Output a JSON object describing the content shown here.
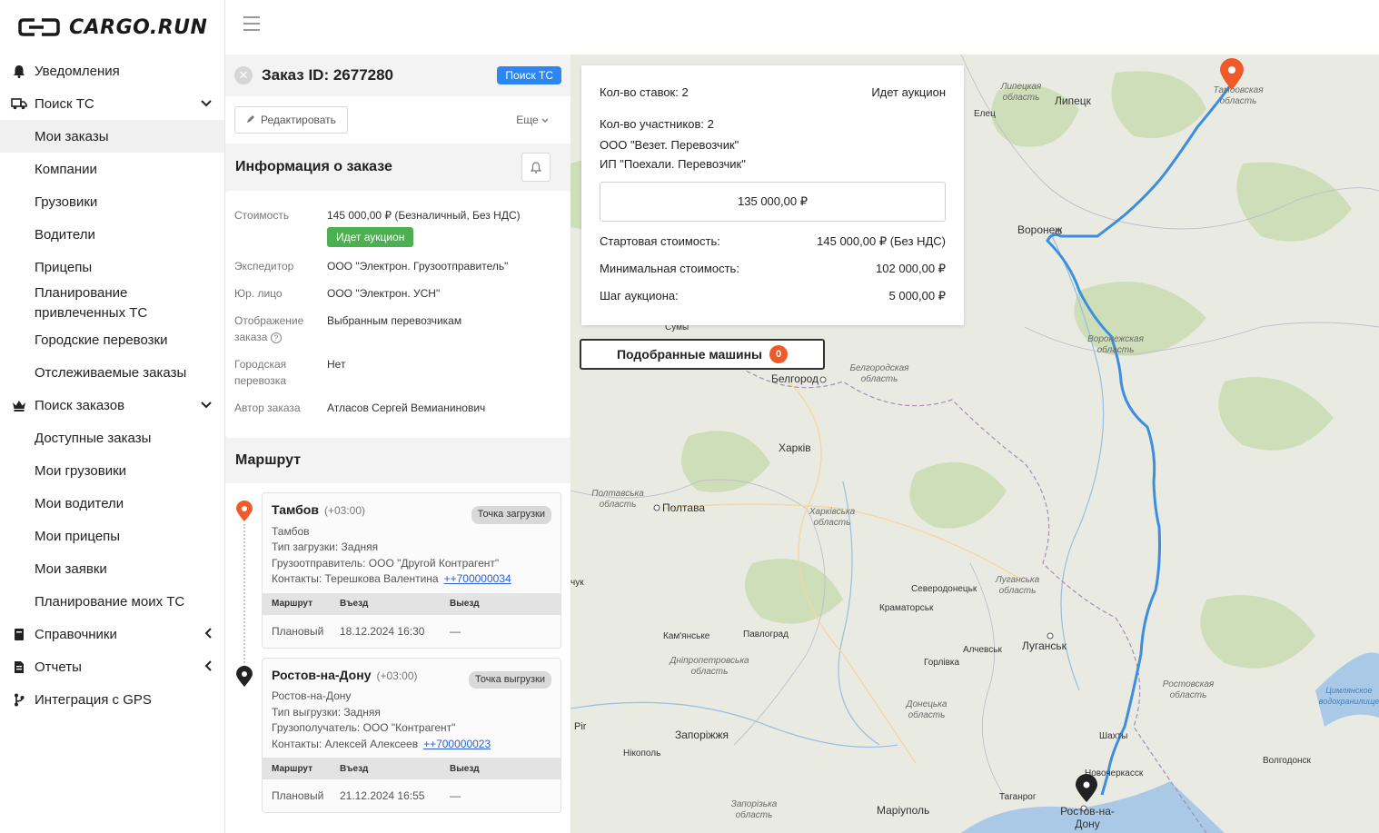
{
  "app": {
    "logo_text": "CARGO.RUN"
  },
  "sidebar": {
    "notifications": "Уведомления",
    "search_vehicles": {
      "label": "Поиск ТС",
      "children": [
        "Мои заказы",
        "Компании",
        "Грузовики",
        "Водители",
        "Прицепы",
        "Планирование привлеченных ТС",
        "Городские перевозки",
        "Отслеживаемые заказы"
      ]
    },
    "search_orders": {
      "label": "Поиск заказов",
      "children": [
        "Доступные заказы",
        "Мои грузовики",
        "Мои водители",
        "Мои прицепы",
        "Мои заявки",
        "Планирование моих ТС"
      ]
    },
    "references": "Справочники",
    "reports": "Отчеты",
    "gps": "Интеграция с GPS"
  },
  "order": {
    "title": "Заказ ID: 2677280",
    "status_badge": "Поиск ТС",
    "edit_label": "Редактировать",
    "more_label": "Еще",
    "info_title": "Информация о заказе",
    "info": {
      "cost_key": "Стоимость",
      "cost_val": "145 000,00 ₽ (Безналичный, Без НДС)",
      "auction_badge": "Идет аукцион",
      "forwarder_key": "Экспедитор",
      "forwarder_val": "ООО \"Электрон. Грузоотправитель\"",
      "legal_key": "Юр. лицо",
      "legal_val": "ООО \"Электрон. УСН\"",
      "display_key": "Отображение заказа",
      "display_val": "Выбранным перевозчикам",
      "city_key": "Городская перевозка",
      "city_val": "Нет",
      "author_key": "Автор заказа",
      "author_val": "Атласов Сергей Вемианинович"
    },
    "route_title": "Маршрут",
    "table_headers": {
      "route": "Маршрут",
      "in": "Въезд",
      "out": "Выезд"
    },
    "stops": [
      {
        "city": "Тамбов",
        "tz": "(+03:00)",
        "type": "Точка загрузки",
        "address": "Тамбов",
        "line1": "Тип загрузки: Задняя",
        "line2": "Грузоотправитель: ООО \"Другой Контрагент\"",
        "contact": "Контакты: Терешкова Валентина",
        "phone": "++700000034",
        "plan_label": "Плановый",
        "plan_in": "18.12.2024 16:30",
        "plan_out": "—"
      },
      {
        "city": "Ростов-на-Дону",
        "tz": "(+03:00)",
        "type": "Точка выгрузки",
        "address": "Ростов-на-Дону",
        "line1": "Тип выгрузки: Задняя",
        "line2": "Грузополучатель: ООО \"Контрагент\"",
        "contact": "Контакты: Алексей Алексеев",
        "phone": "++700000023",
        "plan_label": "Плановый",
        "plan_in": "21.12.2024 16:55",
        "plan_out": "—"
      }
    ]
  },
  "auction": {
    "bids": "Кол-во ставок: 2",
    "status": "Идет аукцион",
    "participants": "Кол-во участников: 2",
    "participant_1": "ООО \"Везет. Перевозчик\"",
    "participant_2": "ИП \"Поехали. Перевозчик\"",
    "current_bid": "135 000,00 ₽",
    "start_key": "Стартовая стоимость:",
    "start_val": "145 000,00 ₽ (Без НДС)",
    "min_key": "Минимальная стоимость:",
    "min_val": "102 000,00 ₽",
    "step_key": "Шаг аукциона:",
    "step_val": "5 000,00 ₽",
    "matched_label": "Подобранные машины",
    "matched_count": "0"
  },
  "map": {
    "cities": [
      "Липецк",
      "Елец",
      "Воронеж",
      "Белгород",
      "Харків",
      "Полтава",
      "Сумы",
      "Северодонецьк",
      "Краматорськ",
      "Кам'янське",
      "Павлоград",
      "Алчевськ",
      "Луганськ",
      "Горлівка",
      "Запоріжжя",
      "Нікополь",
      "Маріуполь",
      "Таганрог",
      "Шахты",
      "Новочеркасск",
      "Ростов-на-Дону",
      "Волгодонск",
      "Pir",
      "чук"
    ],
    "regions": [
      "Липецкая область",
      "Тамбовская область",
      "Воронежская область",
      "Белгородская область",
      "Полтавська область",
      "Харківська область",
      "Луганська область",
      "Дніпропетровська область",
      "Донецька область",
      "Ростовская область",
      "Запорізька область",
      "Цимлянское водохранилище"
    ]
  }
}
